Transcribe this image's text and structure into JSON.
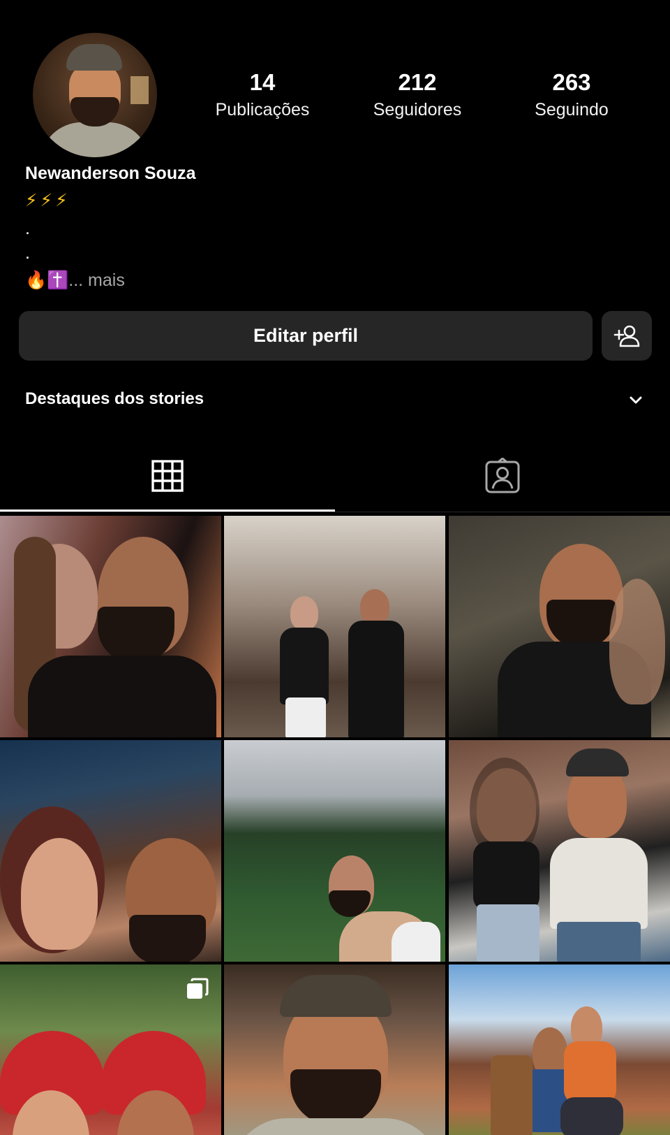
{
  "profile": {
    "name": "Newanderson Souza",
    "bio_line1": "⚡⚡⚡",
    "bio_line2": ".",
    "bio_line3": ".",
    "bio_line4": "🔥✝️",
    "more_label": "... mais"
  },
  "stats": {
    "posts": {
      "value": "14",
      "label": "Publicações"
    },
    "followers": {
      "value": "212",
      "label": "Seguidores"
    },
    "following": {
      "value": "263",
      "label": "Seguindo"
    }
  },
  "actions": {
    "edit_profile_label": "Editar perfil",
    "add_person_icon": "add-person-icon"
  },
  "highlights": {
    "label": "Destaques dos stories",
    "expand_icon": "chevron-down-icon"
  },
  "tabs": [
    {
      "icon": "grid-icon",
      "active": true
    },
    {
      "icon": "tagged-person-icon",
      "active": false
    }
  ],
  "posts": [
    {
      "icon": null
    },
    {
      "icon": null
    },
    {
      "icon": null
    },
    {
      "icon": null
    },
    {
      "icon": null
    },
    {
      "icon": null
    },
    {
      "icon": "multiple-photos-icon"
    },
    {
      "icon": null
    },
    {
      "icon": null
    }
  ],
  "colors": {
    "background": "#000000",
    "button_bg": "#262626",
    "text": "#ffffff",
    "muted_text": "#a8a8a8"
  }
}
